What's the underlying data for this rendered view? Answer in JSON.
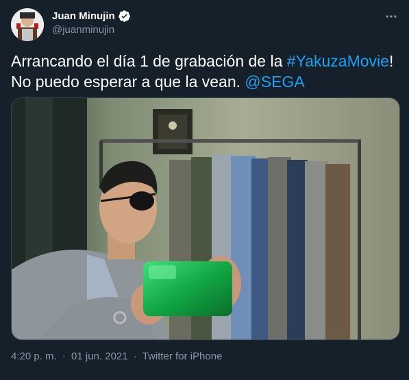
{
  "author": {
    "display_name": "Juan Minujin",
    "handle": "@juanminujin",
    "verified": true
  },
  "icons": {
    "verified": "verified-badge-icon",
    "more": "more-options-icon"
  },
  "tweet": {
    "line1_prefix": "Arrancando el día 1 de grabación de la ",
    "hashtag": "#YakuzaMovie",
    "line1_suffix": "!",
    "line2_prefix": "No puedo esperar a que la vean. ",
    "mention": "@SEGA"
  },
  "footer": {
    "time": "4:20 p. m.",
    "separator1": "·",
    "date": "01 jun. 2021",
    "separator2": "·",
    "client": "Twitter for iPhone"
  },
  "colors": {
    "background": "#15202b",
    "link": "#1da1f2",
    "secondary_text": "#8899a6",
    "verified": "#ffffff"
  }
}
